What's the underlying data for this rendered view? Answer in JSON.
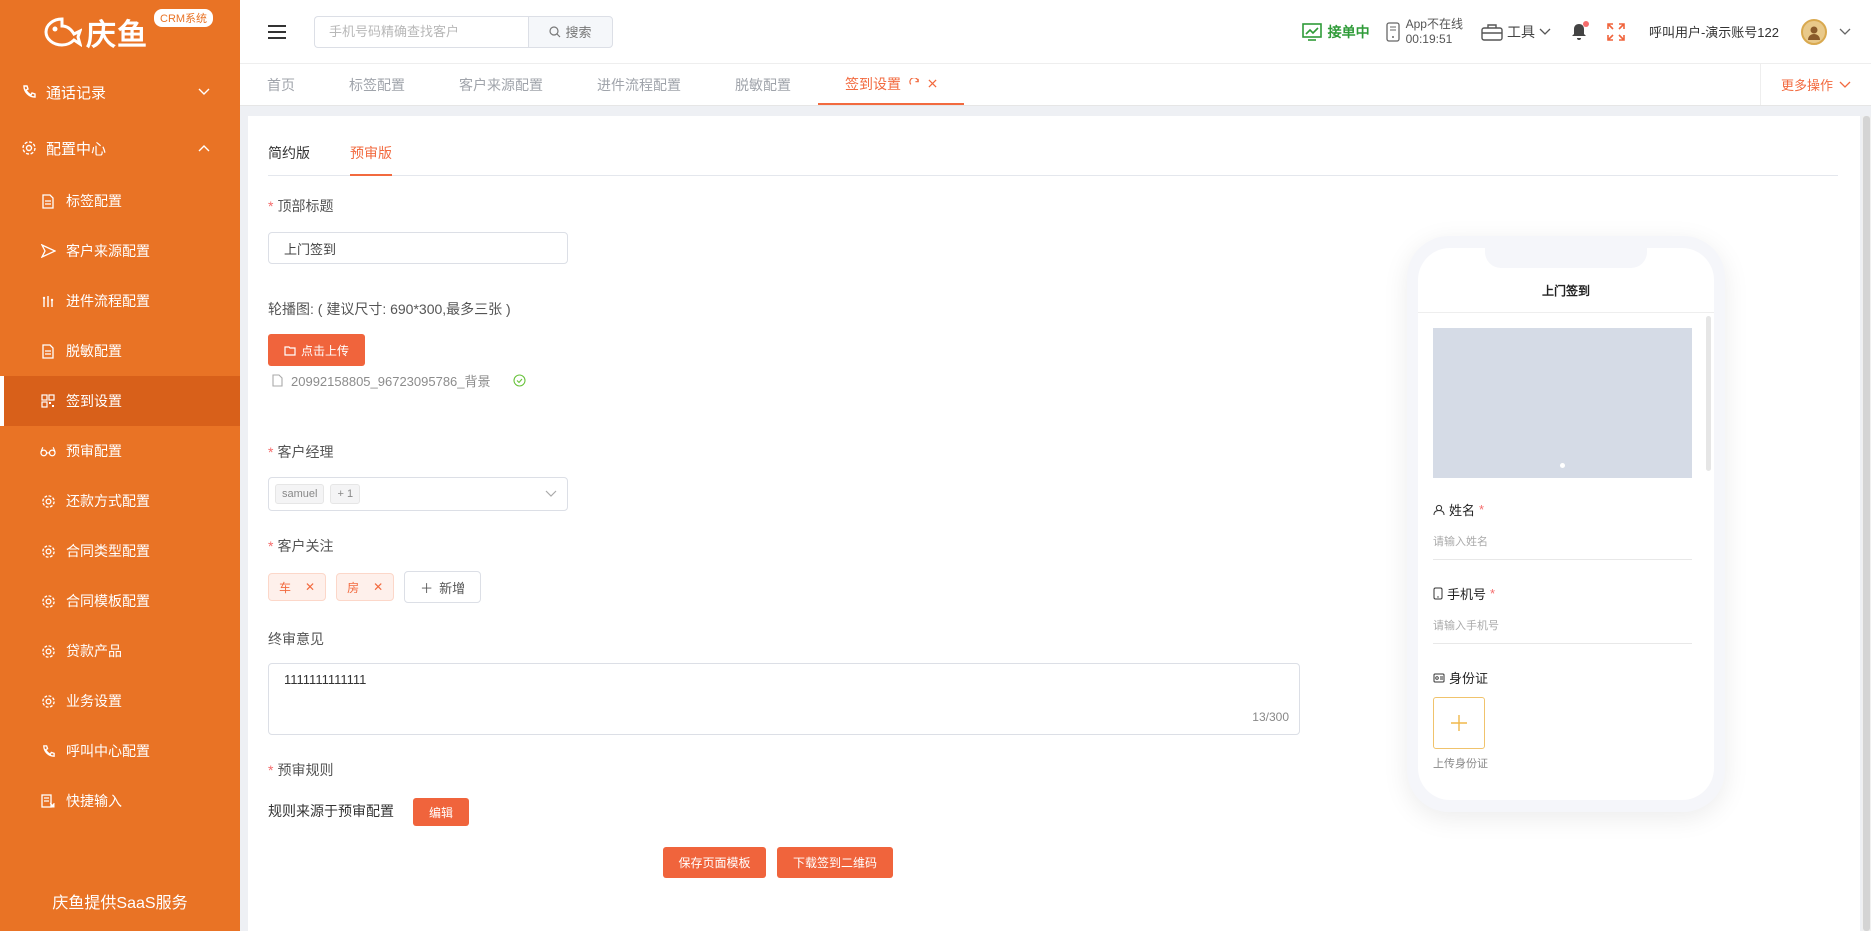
{
  "colors": {
    "sidebar": "#e97325",
    "accent": "#f26a3f",
    "button": "#f0643c",
    "online": "#2f9b38"
  },
  "sidebar": {
    "brand": "庆鱼",
    "brand_badge": "CRM系统",
    "groups": [
      {
        "label": "通话记录",
        "icon": "phone-icon",
        "expanded": false
      },
      {
        "label": "配置中心",
        "icon": "gear-icon",
        "expanded": true
      }
    ],
    "items": [
      {
        "label": "标签配置",
        "icon": "document-icon"
      },
      {
        "label": "客户来源配置",
        "icon": "send-icon"
      },
      {
        "label": "进件流程配置",
        "icon": "flow-icon"
      },
      {
        "label": "脱敏配置",
        "icon": "document-icon"
      },
      {
        "label": "签到设置",
        "icon": "qrcode-icon",
        "active": true
      },
      {
        "label": "预审配置",
        "icon": "glasses-icon"
      },
      {
        "label": "还款方式配置",
        "icon": "gear-icon"
      },
      {
        "label": "合同类型配置",
        "icon": "gear-icon"
      },
      {
        "label": "合同模板配置",
        "icon": "gear-icon"
      },
      {
        "label": "贷款产品",
        "icon": "gear-icon"
      },
      {
        "label": "业务设置",
        "icon": "gear-icon"
      },
      {
        "label": "呼叫中心配置",
        "icon": "phone-icon"
      },
      {
        "label": "快捷输入",
        "icon": "keyboard-icon"
      }
    ],
    "footer": "庆鱼提供SaaS服务"
  },
  "header": {
    "search_placeholder": "手机号码精确查找客户",
    "search_button": "搜索",
    "taking_orders": "接单中",
    "app_status_line1": "App不在线",
    "app_status_line2": "00:19:51",
    "tools": "工具",
    "user": "呼叫用户-演示账号122"
  },
  "tabs": [
    {
      "label": "首页"
    },
    {
      "label": "标签配置"
    },
    {
      "label": "客户来源配置"
    },
    {
      "label": "进件流程配置"
    },
    {
      "label": "脱敏配置"
    },
    {
      "label": "签到设置",
      "active": true
    }
  ],
  "more_ops": "更多操作",
  "subtabs": [
    {
      "label": "简约版"
    },
    {
      "label": "预审版",
      "active": true
    }
  ],
  "form": {
    "top_title_label": "顶部标题",
    "top_title_value": "上门签到",
    "carousel_label": "轮播图: ( 建议尺寸: 690*300,最多三张 )",
    "upload_button": "点击上传",
    "uploaded_file": "20992158805_96723095786_背景",
    "manager_label": "客户经理",
    "manager_tags": [
      "samuel",
      "+ 1"
    ],
    "concern_label": "客户关注",
    "concern_tags": [
      "车",
      "房"
    ],
    "add_button": "新增",
    "opinion_label": "终审意见",
    "opinion_value": "1111111111111",
    "opinion_count": "13/300",
    "rule_label": "预审规则",
    "rule_source": "规则来源于预审配置",
    "edit_button": "编辑",
    "save_button": "保存页面模板",
    "download_button": "下载签到二维码"
  },
  "phone": {
    "title": "上门签到",
    "name_label": "姓名",
    "name_placeholder": "请输入姓名",
    "phone_label": "手机号",
    "phone_placeholder": "请输入手机号",
    "id_label": "身份证",
    "id_upload": "上传身份证"
  }
}
